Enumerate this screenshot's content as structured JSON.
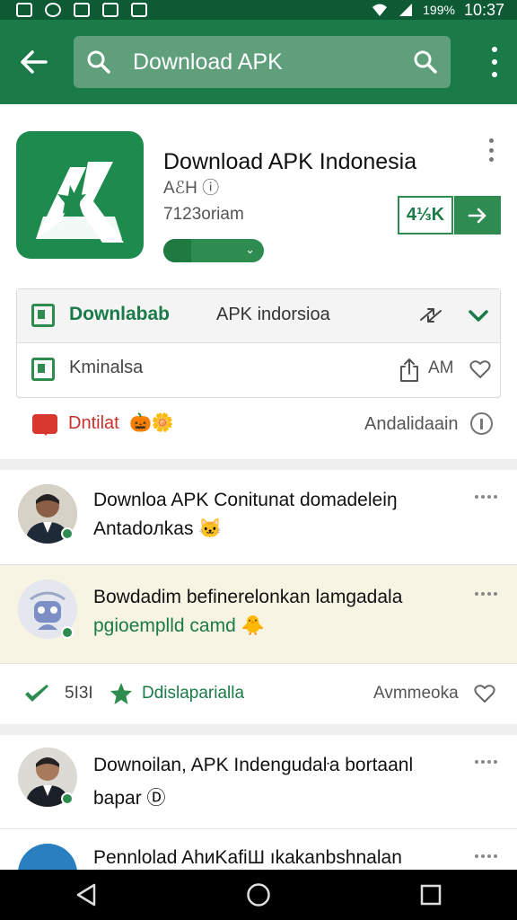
{
  "status_bar": {
    "battery": "199%",
    "time": "10:37"
  },
  "search": {
    "query": "Download APK"
  },
  "app": {
    "title": "Download APK Indonesia",
    "subtitle": "AℰH ⓘ",
    "meta": "7123oriam",
    "progress": 0.28,
    "apk_label": "4⅓K"
  },
  "download_panel": {
    "row1_label": "Downlabab",
    "row1_text": "APK indorsioa",
    "row2_label": "Kminalsa",
    "row2_meta": "AM"
  },
  "app_footer": {
    "left_text": "Dntilat",
    "left_emoji": "🎃🌼",
    "right_text": "Andalidaain"
  },
  "feed": {
    "posts": [
      {
        "line1": "Downloa APK Conitunat domadeleiŋ",
        "line2": "Antadoлkas 🐱"
      },
      {
        "line1": "Bowdadim befinerelonkan lamgadala",
        "line2": "pgioemplld camd 🐥"
      }
    ],
    "actions": {
      "count": "5I3I",
      "label": "Ddislaparialla",
      "right": "Avmmeoka"
    }
  },
  "feed2": {
    "posts": [
      {
        "line1": "Downoilan, APK Indengudaŀa bortaanl",
        "line2": "bapar Ⓓ"
      },
      {
        "line1": "Pennlolad AhиKafiШ ıkakanbshnalan"
      }
    ]
  },
  "colors": {
    "primary": "#1a7a48",
    "status_bar": "#0d5a35",
    "search_bg": "#5f9f7c",
    "accent_red": "#d9382e"
  },
  "icons": [
    "back-arrow-icon",
    "search-icon",
    "overflow-menu-icon",
    "share-icon",
    "heart-icon",
    "star-icon",
    "checkmark-icon",
    "chevron-down-icon",
    "info-icon"
  ]
}
